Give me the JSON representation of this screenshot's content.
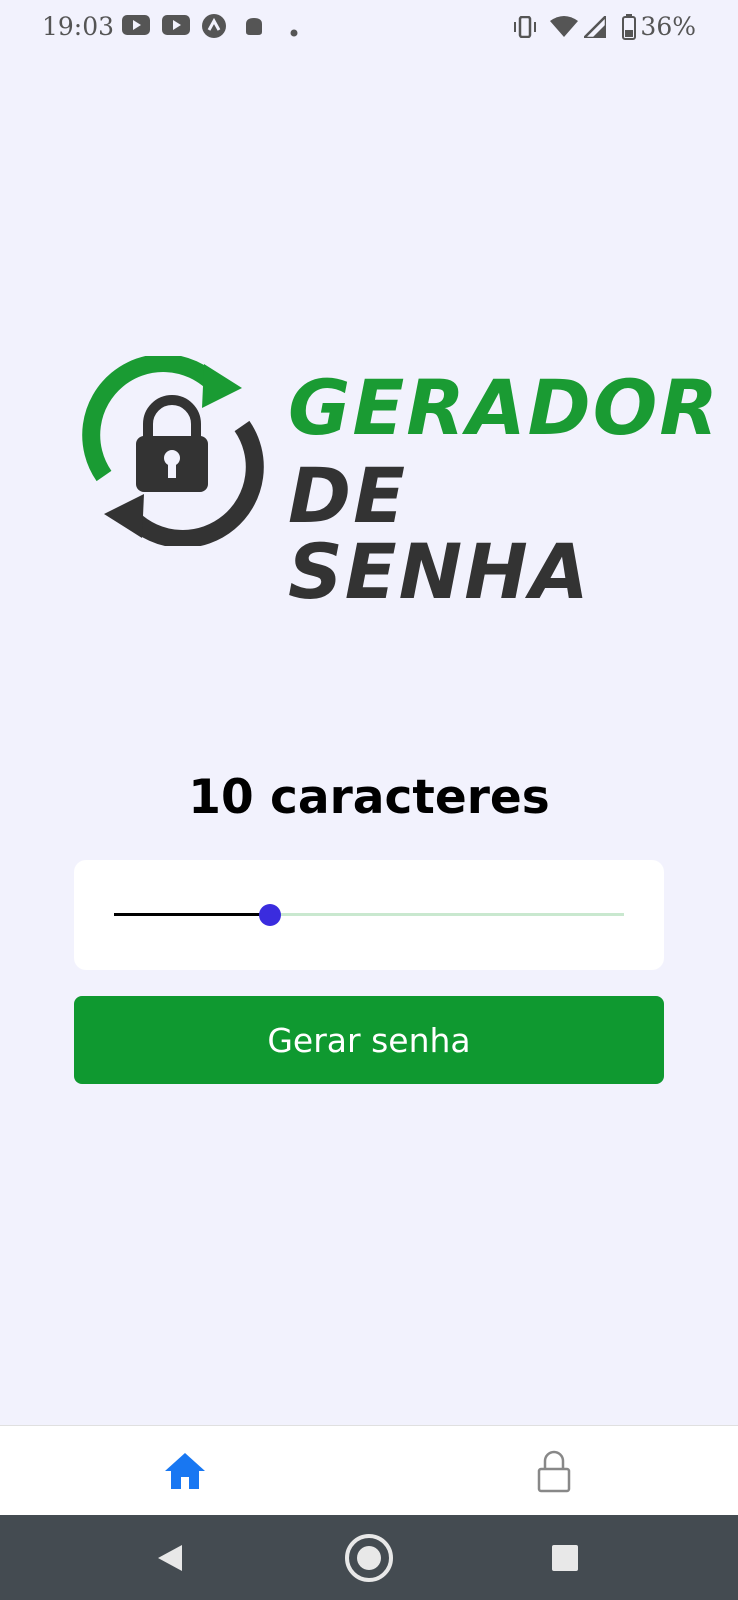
{
  "status_bar": {
    "time": "19:03",
    "battery_percent": "36%",
    "icons_left": [
      "youtube-icon",
      "youtube-icon",
      "app-icon",
      "android-icon",
      "dot-icon"
    ],
    "icons_right": [
      "vibrate-icon",
      "wifi-icon",
      "signal-icon",
      "battery-icon"
    ]
  },
  "logo": {
    "line1": "GERADOR",
    "line2": "DE SENHA",
    "colors": {
      "green": "#1a9b33",
      "dark": "#333333"
    }
  },
  "main": {
    "char_count_label": "10 caracteres",
    "slider": {
      "value": 10,
      "min_fill_fraction": 0.28
    },
    "generate_button_label": "Gerar senha"
  },
  "tab_bar": {
    "tabs": [
      {
        "icon": "home-icon",
        "active": true,
        "color": "#1877f2"
      },
      {
        "icon": "lock-icon",
        "active": false,
        "color": "#888888"
      }
    ]
  },
  "nav_bar": {
    "buttons": [
      "back-icon",
      "home-circle-icon",
      "recents-icon"
    ]
  },
  "colors": {
    "background": "#f2f2fd",
    "button": "#0f9930",
    "slider_thumb": "#3a2cde"
  }
}
